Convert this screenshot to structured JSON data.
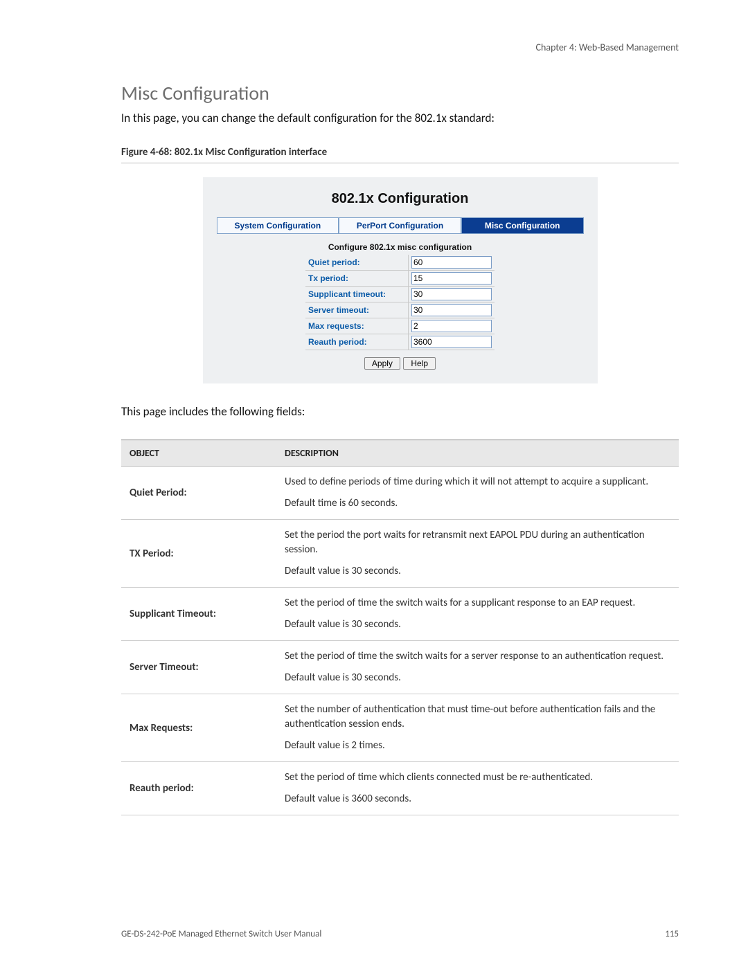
{
  "chapter_line": "Chapter 4: Web-Based Management",
  "section_title": "Misc Configuration",
  "intro": "In this page, you can change the default configuration for the 802.1x standard:",
  "figure_caption": "Figure 4-68: 802.1x Misc Configuration interface",
  "ui": {
    "title": "802.1x Configuration",
    "tabs": {
      "sys": "System Configuration",
      "perport": "PerPort Configuration",
      "misc": "Misc Configuration"
    },
    "sub": "Configure 802.1x misc configuration",
    "rows": {
      "quiet": {
        "label": "Quiet period:",
        "value": "60"
      },
      "tx": {
        "label": "Tx period:",
        "value": "15"
      },
      "supp": {
        "label": "Supplicant timeout:",
        "value": "30"
      },
      "server": {
        "label": "Server timeout:",
        "value": "30"
      },
      "maxreq": {
        "label": "Max requests:",
        "value": "2"
      },
      "reauth": {
        "label": "Reauth period:",
        "value": "3600"
      }
    },
    "btn_apply": "Apply",
    "btn_help": "Help"
  },
  "after_text": "This page includes the following fields:",
  "table": {
    "head_object": "OBJECT",
    "head_desc": "DESCRIPTION",
    "rows": [
      {
        "object": "Quiet Period:",
        "p1": "Used to define periods of time during which it will not attempt to acquire a supplicant.",
        "p2": "Default time is 60 seconds."
      },
      {
        "object": "TX Period:",
        "p1": "Set the period the port waits for retransmit next EAPOL PDU during an authentication session.",
        "p2": "Default value is 30 seconds."
      },
      {
        "object": "Supplicant Timeout:",
        "p1": "Set the period of time the switch waits for a supplicant response to an EAP request.",
        "p2": "Default value is 30 seconds."
      },
      {
        "object": "Server Timeout:",
        "p1": "Set the period of time the switch waits for a server response to an authentication request.",
        "p2": "Default value is 30 seconds."
      },
      {
        "object": "Max Requests:",
        "p1": "Set the number of authentication that must time-out before authentication fails and the authentication session ends.",
        "p2": "Default value is 2 times."
      },
      {
        "object": "Reauth period:",
        "p1": "Set the period of time which clients connected must be re-authenticated.",
        "p2": "Default value is 3600 seconds."
      }
    ]
  },
  "footer_left": "GE-DS-242-PoE Managed Ethernet Switch User Manual",
  "footer_right": "115"
}
